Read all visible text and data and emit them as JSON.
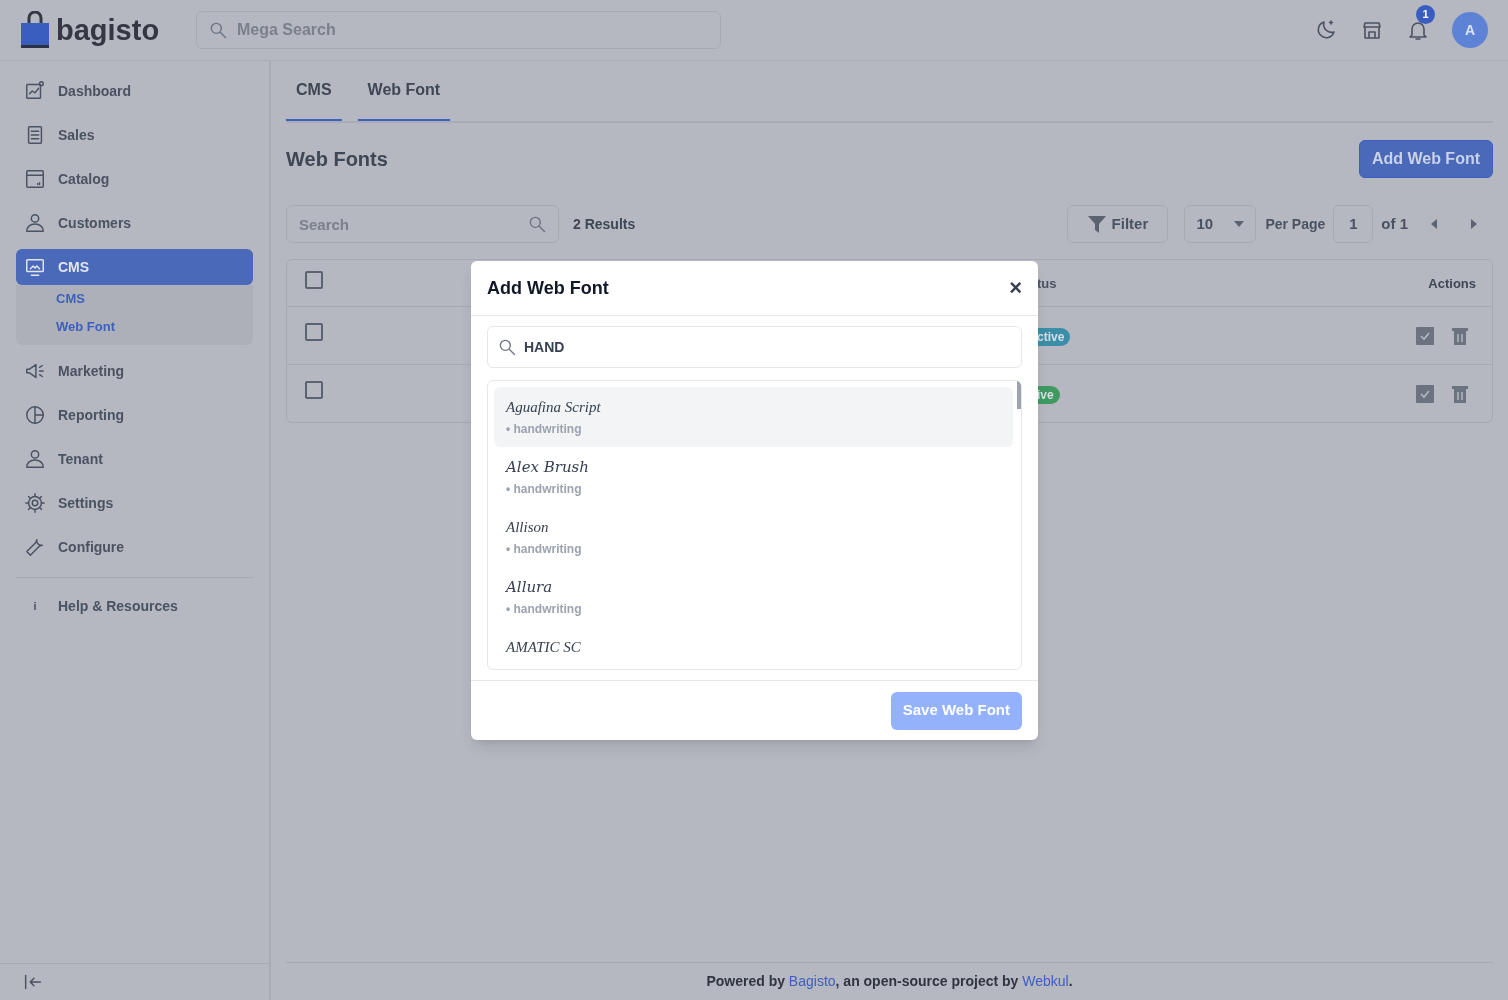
{
  "header": {
    "logo": "bagisto",
    "search": {
      "placeholder": "Mega Search"
    },
    "notifications": "1",
    "avatar": "A"
  },
  "sidebar": {
    "items": [
      {
        "label": "Dashboard",
        "selected": false
      },
      {
        "label": "Sales",
        "selected": false
      },
      {
        "label": "Catalog",
        "selected": false
      },
      {
        "label": "Customers",
        "selected": false
      },
      {
        "label": "CMS",
        "selected": true,
        "children": [
          {
            "label": "CMS"
          },
          {
            "label": "Web Font"
          }
        ]
      },
      {
        "label": "Marketing",
        "selected": false
      },
      {
        "label": "Reporting",
        "selected": false
      },
      {
        "label": "Tenant",
        "selected": false
      },
      {
        "label": "Settings",
        "selected": false
      },
      {
        "label": "Configure",
        "selected": false
      }
    ],
    "help": {
      "icon": "i",
      "label": "Help & Resources"
    }
  },
  "tabs": [
    {
      "label": "CMS",
      "selected": true
    },
    {
      "label": "Web Font",
      "selected": true
    }
  ],
  "page": {
    "title": "Web Fonts",
    "add_button": "Add Web Font"
  },
  "toolbar": {
    "search": {
      "placeholder": "Search"
    },
    "results": "2 Results",
    "filter": "Filter",
    "per_page_value": "10",
    "per_page_label": "Per Page",
    "page": "1",
    "of": "of 1"
  },
  "table": {
    "columns": [
      "tus",
      "Actions"
    ],
    "all_checked": false,
    "rows": [
      {
        "status": "ctive",
        "color": "#3b8ea8",
        "checked": false
      },
      {
        "status": "ive",
        "color": "#3f9a62",
        "checked": false
      }
    ]
  },
  "modal": {
    "title": "Add Web Font",
    "close": "×",
    "search": {
      "value": "HAND"
    },
    "fonts": [
      {
        "name": "Aguafina Script",
        "category": "• handwriting",
        "selected": true
      },
      {
        "name": "Alex Brush",
        "category": "• handwriting",
        "selected": false
      },
      {
        "name": "Allison",
        "category": "• handwriting",
        "selected": false
      },
      {
        "name": "Allura",
        "category": "• handwriting",
        "selected": false
      },
      {
        "name": "AMATIC SC",
        "selected": false
      }
    ],
    "save_button": "Save Web Font"
  },
  "footer": {
    "text": "Powered by **Bagisto**, an open-source project by **Webkul**."
  }
}
